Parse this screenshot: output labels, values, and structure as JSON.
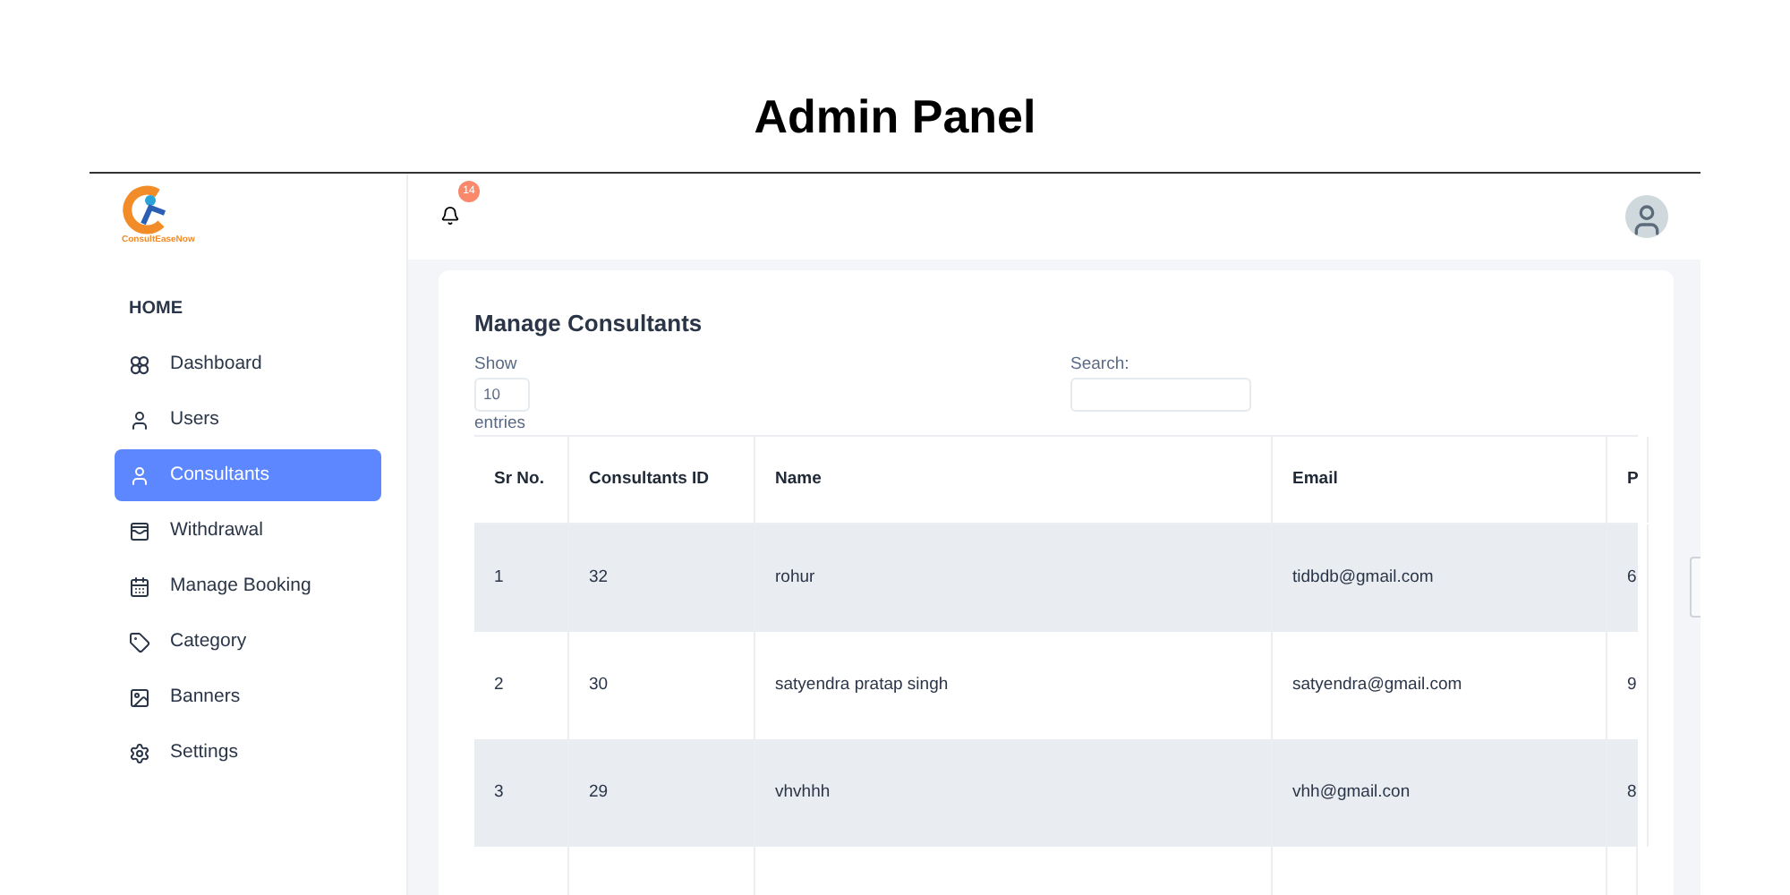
{
  "page_title": "Admin Panel",
  "logo": {
    "text": "ConsultEaseNow"
  },
  "sidebar": {
    "section": "HOME",
    "items": [
      {
        "label": "Dashboard",
        "selected": false
      },
      {
        "label": "Users",
        "selected": false
      },
      {
        "label": "Consultants",
        "selected": true
      },
      {
        "label": "Withdrawal",
        "selected": false
      },
      {
        "label": "Manage Booking",
        "selected": false
      },
      {
        "label": "Category",
        "selected": false
      },
      {
        "label": "Banners",
        "selected": false
      },
      {
        "label": "Settings",
        "selected": false
      }
    ]
  },
  "topbar": {
    "notification_count": "14"
  },
  "card": {
    "title": "Manage Consultants",
    "show_label": "Show",
    "entries_value": "10",
    "entries_label": "entries",
    "search_label": "Search:"
  },
  "table": {
    "columns": [
      "Sr No.",
      "Consultants ID",
      "Name",
      "Email",
      "P"
    ],
    "rows": [
      [
        "1",
        "32",
        "rohur",
        "tidbdb@gmail.com",
        "6"
      ],
      [
        "2",
        "30",
        "satyendra pratap singh",
        "satyendra@gmail.com",
        "9"
      ],
      [
        "3",
        "29",
        "vhvhhh",
        "vhh@gmail.con",
        "8"
      ]
    ]
  }
}
